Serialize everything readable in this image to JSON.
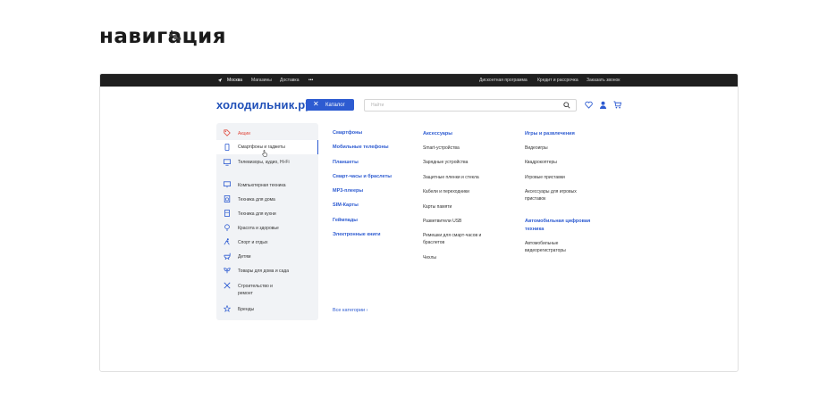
{
  "page_title": "навигация",
  "header": {
    "city": "Москва",
    "links": [
      "Магазины",
      "Доставка"
    ],
    "more": "•••",
    "right_links": [
      "Дисконтная программа",
      "Кредит и рассрочка",
      "Заказать звонок"
    ]
  },
  "site": {
    "logo": "холодильник.ру",
    "catalog_button": "Каталог",
    "search_placeholder": "Найти"
  },
  "sidebar": {
    "items": [
      {
        "label": "Акции",
        "icon": "tag-icon"
      },
      {
        "label": "Смартфоны и гаджеты",
        "icon": "smartphone-icon"
      },
      {
        "label": "Телевизоры, аудио, Hi-Fi",
        "icon": "tv-icon"
      },
      {
        "label": "Компьютерная техника",
        "icon": "monitor-icon"
      },
      {
        "label": "Техника для дома",
        "icon": "washer-icon"
      },
      {
        "label": "Техника для кухни",
        "icon": "fridge-icon"
      },
      {
        "label": "Красота и здоровье",
        "icon": "beauty-icon"
      },
      {
        "label": "Спорт и отдых",
        "icon": "sport-icon"
      },
      {
        "label": "Детям",
        "icon": "stroller-icon"
      },
      {
        "label": "Товары для дома и сада",
        "icon": "garden-icon"
      },
      {
        "label": "Строительство и ремонт",
        "icon": "tools-icon"
      },
      {
        "label": "Бренды",
        "icon": "star-icon"
      }
    ]
  },
  "col1": {
    "links": [
      "Смартфоны",
      "Мобильные телефоны",
      "Планшеты",
      "Смарт-часы и браслеты",
      "MP3-плееры",
      "SIM-Карты",
      "Геймпады",
      "Электронные книги"
    ],
    "all_categories": "Все категории ›"
  },
  "col2": {
    "heading": "Аксессуары",
    "items": [
      "Smart-устройства",
      "Зарядные устройства",
      "Защитные пленки и стекла",
      "Кабели и переходники",
      "Карты памяти",
      "Разветвители USB",
      "Ремешки для смарт-часов и браслетов",
      "Чехлы"
    ]
  },
  "col3": {
    "heading1": "Игры и развлечения",
    "items1": [
      "Видеоигры",
      "Квадрокоптеры",
      "Игровые приставки",
      "Аксессуары для игровых приставок"
    ],
    "heading2": "Автомобильная цифровая техника",
    "items2": [
      "Автомобильные видеорегистраторы"
    ]
  }
}
